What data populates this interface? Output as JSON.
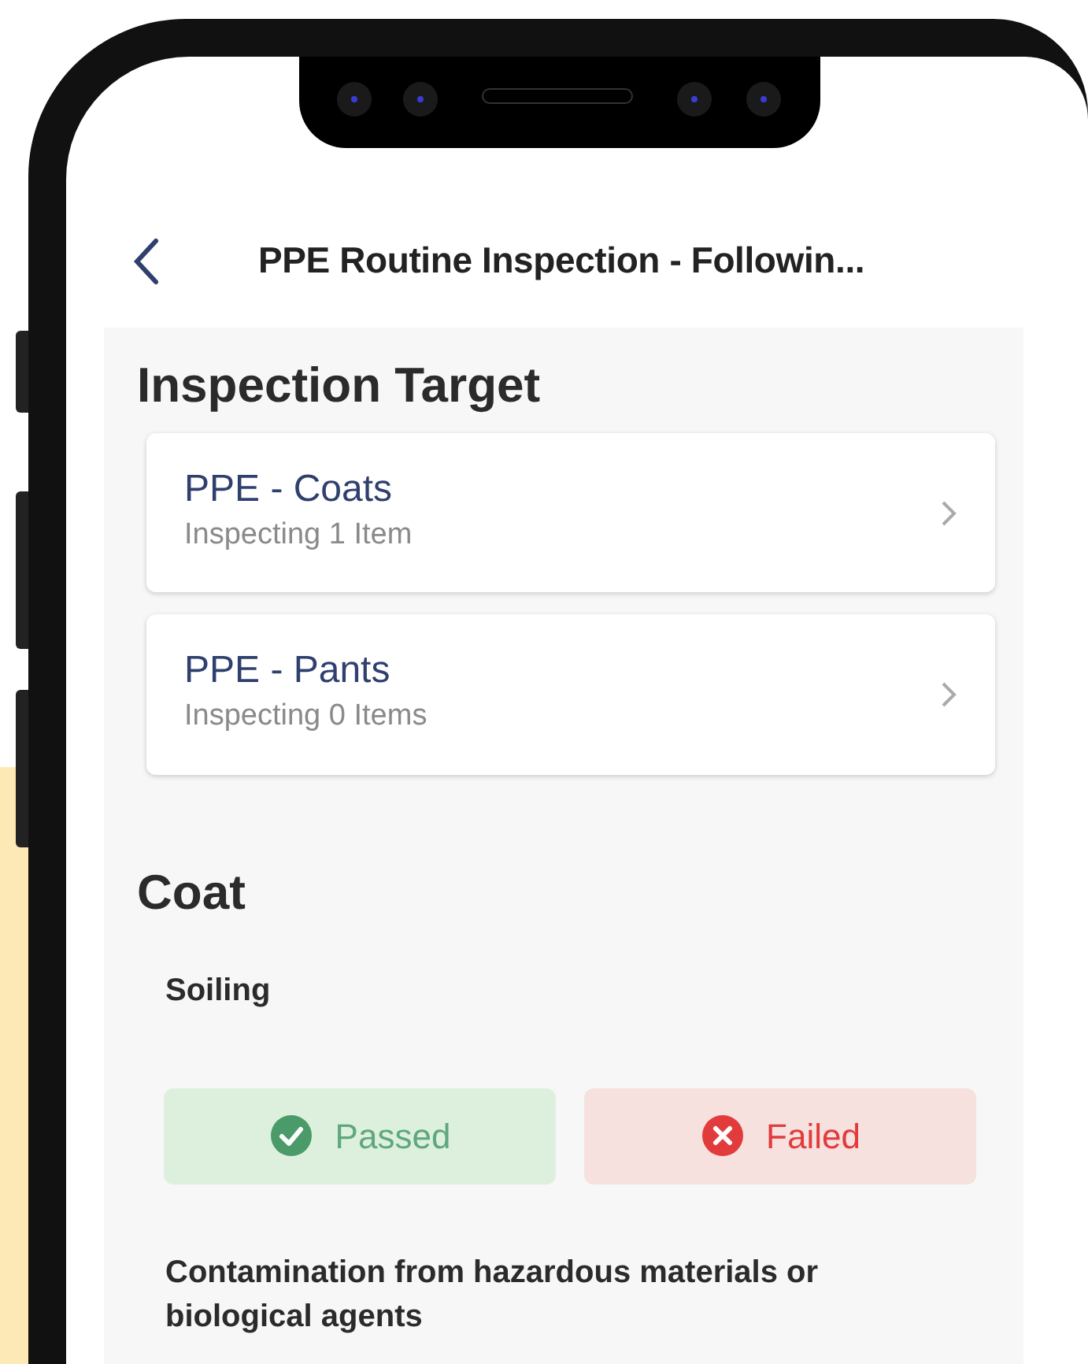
{
  "header": {
    "title": "PPE Routine Inspection - Followin..."
  },
  "sections": [
    {
      "kind": "targets",
      "title": "Inspection Target",
      "items": [
        {
          "name": "PPE - Coats",
          "detail": "Inspecting 1 Item"
        },
        {
          "name": "PPE - Pants",
          "detail": "Inspecting 0 Items"
        }
      ]
    },
    {
      "kind": "checks",
      "title": "Coat",
      "questions": [
        {
          "label": "Soiling",
          "options": [
            {
              "kind": "pass",
              "label": "Passed",
              "selected": false
            },
            {
              "kind": "fail",
              "label": "Failed",
              "selected": false
            }
          ]
        },
        {
          "label": "Contamination from hazardous materials or biological agents"
        }
      ]
    }
  ]
}
